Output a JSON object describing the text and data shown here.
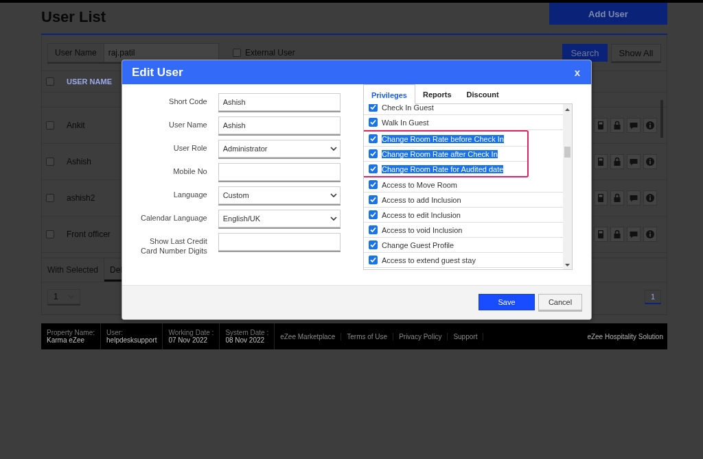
{
  "page": {
    "title": "User List",
    "add_button": "Add User"
  },
  "search": {
    "label": "User Name",
    "value": "raj.patil",
    "external_user": {
      "label": "External User",
      "checked": false
    },
    "buttons": [
      "Search",
      "Show All"
    ]
  },
  "table": {
    "select_all": {
      "checked": false
    },
    "columns": [
      "USER NAME"
    ],
    "rows": [
      {
        "name": "Ankit",
        "checked": false
      },
      {
        "name": "Ashish",
        "checked": false
      },
      {
        "name": "ashish2",
        "checked": false
      },
      {
        "name": "Front officer",
        "checked": false
      }
    ]
  },
  "bulk": {
    "label": "With Selected",
    "action": "Del"
  },
  "pager": {
    "page_size": "1",
    "current_page": "1"
  },
  "footer": {
    "fields": [
      {
        "label": "Property Name:",
        "value": "Karma eZee"
      },
      {
        "label": "User:",
        "value": "helpdesksupport"
      },
      {
        "label": "Working Date :",
        "value": "07 Nov 2022"
      },
      {
        "label": "System Date :",
        "value": "08 Nov 2022"
      }
    ],
    "links": [
      "eZee Marketplace",
      "Terms of Use",
      "Privacy Policy",
      "Support"
    ],
    "brand": "eZee Hospitality Solution"
  },
  "dialog": {
    "title": "Edit User",
    "close": "x",
    "fields": [
      {
        "label": "Short Code",
        "kind": "text",
        "value": "Ashish"
      },
      {
        "label": "User Name",
        "kind": "text",
        "value": "Ashish"
      },
      {
        "label": "User Role",
        "kind": "select",
        "value": "Administrator"
      },
      {
        "label": "Mobile No",
        "kind": "text"
      },
      {
        "label": "Language",
        "kind": "select",
        "value": "Custom"
      },
      {
        "label": "Calendar Language",
        "kind": "select",
        "value": "English/UK"
      },
      {
        "label": "Show Last Credit Card Number Digits",
        "kind": "text"
      }
    ],
    "tabs": [
      {
        "label": "Privileges",
        "selected": true
      },
      {
        "label": "Reports",
        "selected": false
      },
      {
        "label": "Discount",
        "selected": false
      }
    ],
    "privileges": [
      {
        "label": "Check In Guest",
        "checked": true,
        "selected": false,
        "marked": false
      },
      {
        "label": "Walk In Guest",
        "checked": true,
        "selected": false,
        "marked": false
      },
      {
        "label": "Change Room Rate before Check In",
        "checked": true,
        "selected": true,
        "marked": true
      },
      {
        "label": "Change Room Rate after Check In",
        "checked": true,
        "selected": true,
        "marked": true
      },
      {
        "label": "Change Room Rate for Audited date",
        "checked": true,
        "selected": true,
        "marked": true
      },
      {
        "label": "Access to Move Room",
        "checked": true,
        "selected": false,
        "marked": false
      },
      {
        "label": "Access to add Inclusion",
        "checked": true,
        "selected": false,
        "marked": false
      },
      {
        "label": "Access to edit Inclusion",
        "checked": true,
        "selected": false,
        "marked": false
      },
      {
        "label": "Access to void Inclusion",
        "checked": true,
        "selected": false,
        "marked": false
      },
      {
        "label": "Change Guest Profile",
        "checked": true,
        "selected": false,
        "marked": false
      },
      {
        "label": "Access to extend guest stay",
        "checked": true,
        "selected": false,
        "marked": false
      }
    ],
    "buttons": [
      {
        "label": "Save",
        "kind": "primary"
      },
      {
        "label": "Cancel",
        "kind": "secondary"
      }
    ]
  }
}
